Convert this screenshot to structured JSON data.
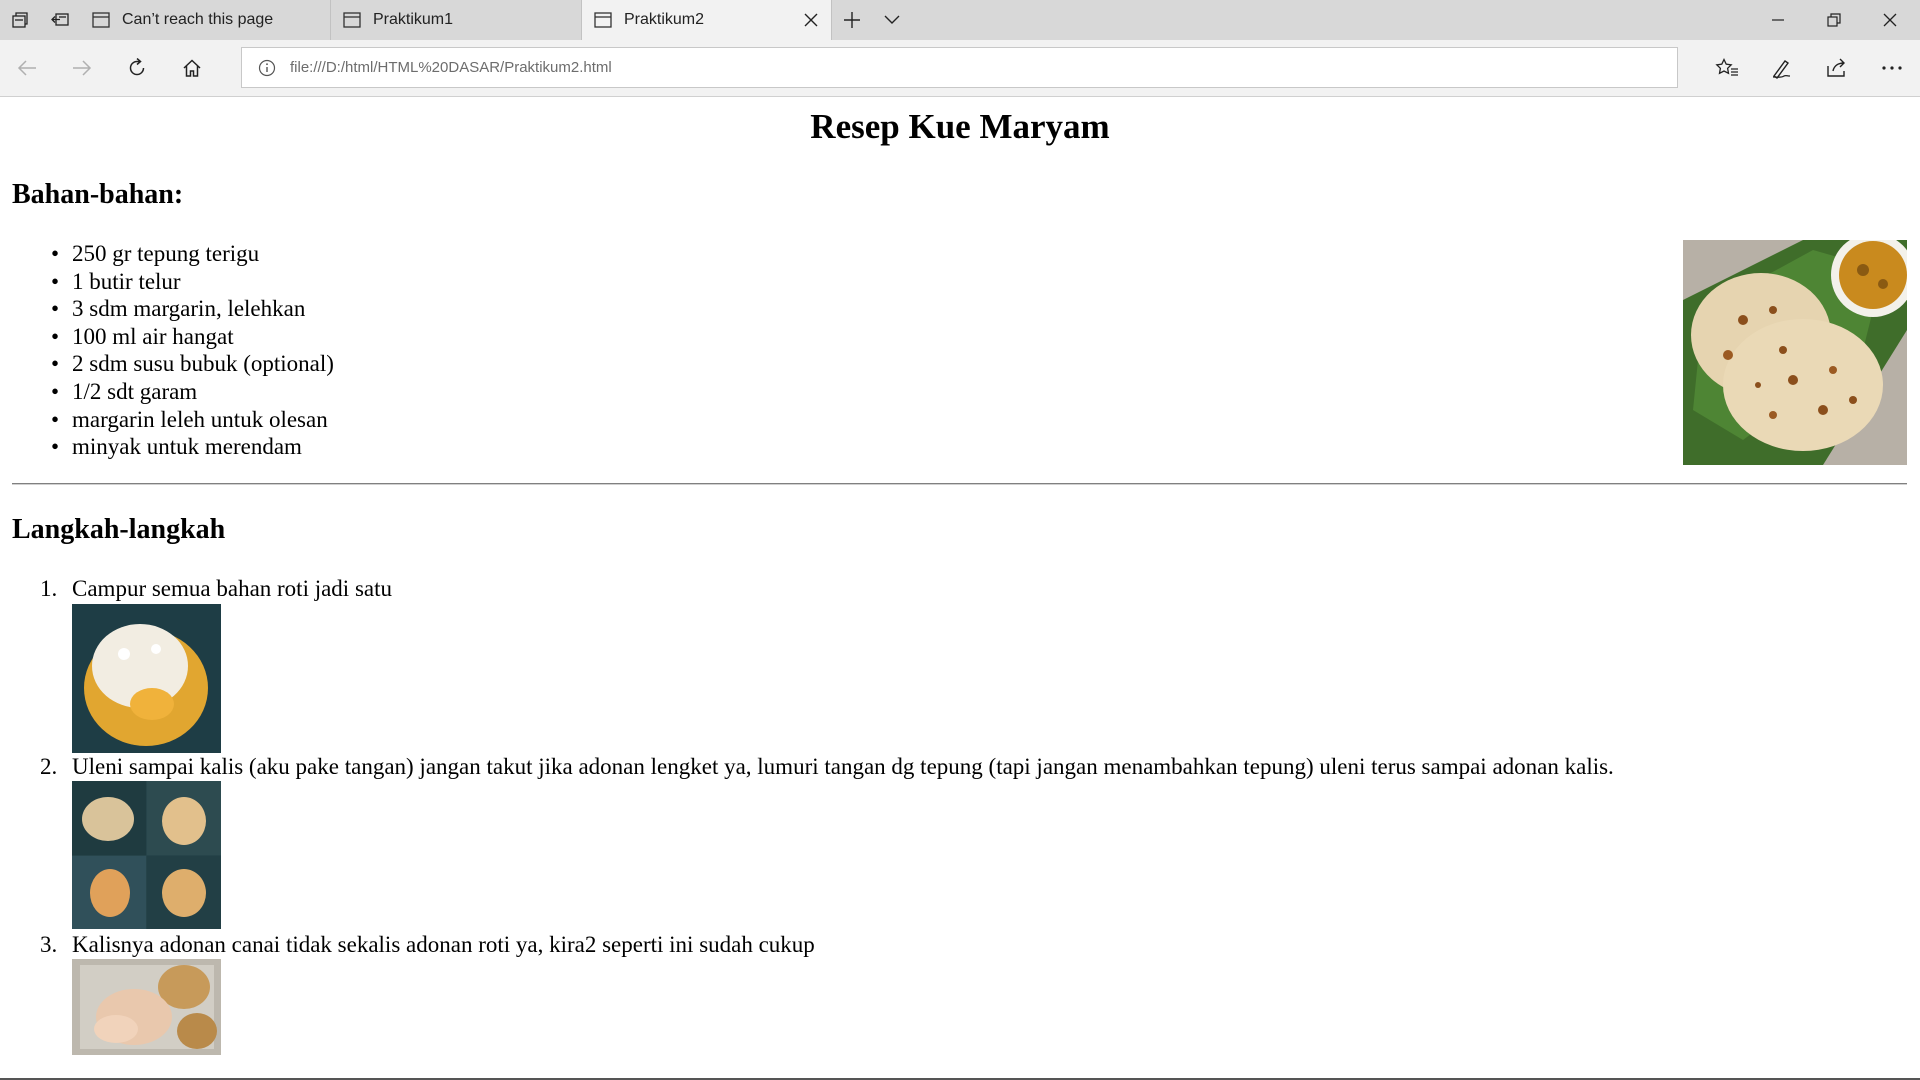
{
  "browser": {
    "tabs": [
      {
        "title": "Can’t reach this page",
        "active": false
      },
      {
        "title": "Praktikum1",
        "active": false
      },
      {
        "title": "Praktikum2",
        "active": true
      }
    ],
    "address": "file:///D:/html/HTML%20DASAR/Praktikum2.html"
  },
  "page": {
    "title": "Resep Kue Maryam",
    "ingredients_heading": "Bahan-bahan:",
    "ingredients": [
      "250 gr tepung terigu",
      "1 butir telur",
      "3 sdm margarin, lelehkan",
      "100 ml air hangat",
      "2 sdm susu bubuk (optional)",
      "1/2 sdt garam",
      "margarin leleh untuk olesan",
      "minyak untuk merendam"
    ],
    "steps_heading": "Langkah-langkah",
    "steps": [
      {
        "number": "1.",
        "text": "Campur semua bahan roti jadi satu"
      },
      {
        "number": "2.",
        "text": "Uleni sampai kalis (aku pake tangan) jangan takut jika adonan lengket ya, lumuri tangan dg tepung (tapi jangan menambahkan tepung) uleni terus sampai adonan kalis."
      },
      {
        "number": "3.",
        "text": "Kalisnya adonan canai tidak sekalis adonan roti ya, kira2 seperti ini sudah cukup"
      }
    ]
  },
  "icons": {
    "tab_actions": "tab-actions-icon",
    "set_aside": "set-tabs-aside-icon",
    "page": "page-icon",
    "close": "close-icon",
    "new_tab": "plus-icon",
    "tab_list": "chevron-down-icon",
    "minimize": "minimize-icon",
    "restore": "restore-icon",
    "window_close": "window-close-icon",
    "back": "back-arrow-icon",
    "forward": "forward-arrow-icon",
    "refresh": "refresh-icon",
    "home": "home-icon",
    "info": "info-icon",
    "favorites": "favorites-icon",
    "notes": "web-note-icon",
    "share": "share-icon",
    "more": "more-icon"
  }
}
